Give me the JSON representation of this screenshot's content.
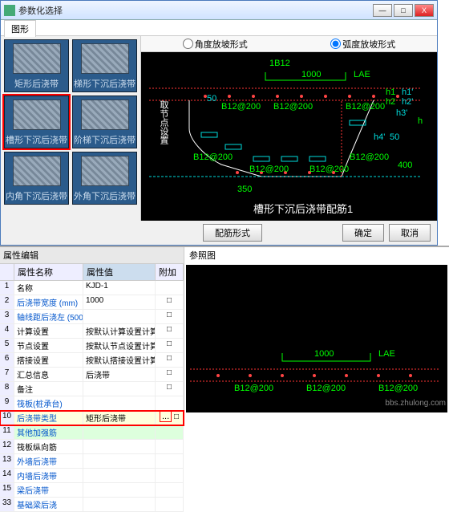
{
  "dialog": {
    "title": "参数化选择",
    "tab": "图形",
    "min": "—",
    "max": "□",
    "close": "X"
  },
  "radios": {
    "angle": "角度放坡形式",
    "arc": "弧度放坡形式"
  },
  "palette": [
    {
      "label": "矩形后浇带"
    },
    {
      "label": "梯形下沉后浇带"
    },
    {
      "label": "槽形下沉后浇带"
    },
    {
      "label": "阶梯下沉后浇带"
    },
    {
      "label": "内角下沉后浇带"
    },
    {
      "label": "外角下沉后浇带"
    }
  ],
  "cad1": {
    "title": "槽形下沉后浇带配筋1",
    "top_rebar": "1B12",
    "dim1000": "1000",
    "lae": "LAE",
    "b12_200": "B12@200",
    "node_text": "取节点设置",
    "h_main": "h",
    "h1": "h1",
    "h1p": "h1'",
    "h2": "h2",
    "h2p": "h2'",
    "h3": "h3'",
    "h4": "h4'",
    "n50": "50",
    "n350": "350",
    "n400": "400"
  },
  "buttons": {
    "style": "配筋形式",
    "ok": "确定",
    "cancel": "取消"
  },
  "prop": {
    "title": "属性编辑",
    "head": {
      "name": "属性名称",
      "value": "属性值",
      "extra": "附加"
    },
    "prevTitle": "参照图",
    "rows": [
      {
        "n": "1",
        "k": "名称",
        "v": "KJD-1"
      },
      {
        "n": "2",
        "k": "后浇带宽度 (mm)",
        "v": "1000"
      },
      {
        "n": "3",
        "k": "轴线距后浇左 (500)",
        "v": ""
      },
      {
        "n": "4",
        "k": "计算设置",
        "v": "按默认计算设置计算"
      },
      {
        "n": "5",
        "k": "节点设置",
        "v": "按默认节点设置计算"
      },
      {
        "n": "6",
        "k": "搭接设置",
        "v": "按默认搭接设置计算"
      },
      {
        "n": "7",
        "k": "汇总信息",
        "v": "后浇带"
      },
      {
        "n": "8",
        "k": "备注",
        "v": ""
      },
      {
        "n": "9",
        "k": "筏板(桩承台)",
        "v": ""
      },
      {
        "n": "10",
        "k": "后浇带类型",
        "v": "矩形后浇带"
      },
      {
        "n": "11",
        "k": "其他加强筋",
        "v": ""
      },
      {
        "n": "12",
        "k": "筏板纵向筋",
        "v": ""
      },
      {
        "n": "13",
        "k": "外墙后浇带",
        "v": ""
      },
      {
        "n": "14",
        "k": "内墙后浇带",
        "v": ""
      },
      {
        "n": "15",
        "k": "梁后浇带",
        "v": ""
      },
      {
        "n": "33",
        "k": "基础梁后浇",
        "v": ""
      }
    ],
    "checkbox": "□"
  },
  "cad2": {
    "dim1000": "1000",
    "lae": "LAE",
    "b12": "B12@200"
  },
  "watermark": "bbs.zhulong.com"
}
